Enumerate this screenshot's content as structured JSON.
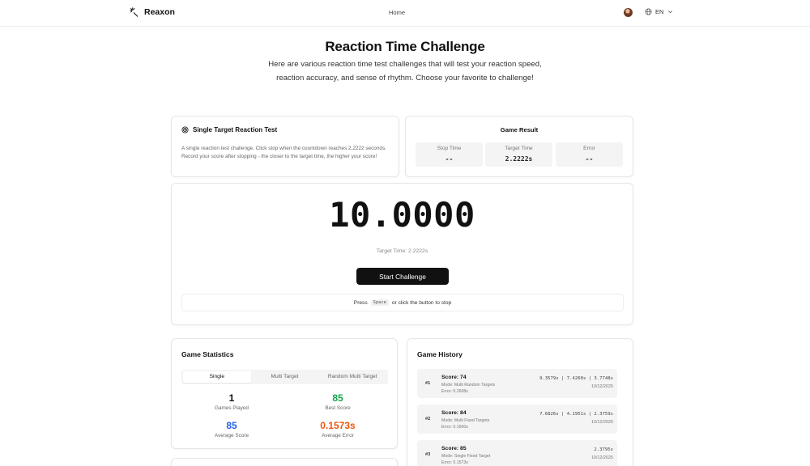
{
  "header": {
    "brand": "Reaxon",
    "nav_home": "Home",
    "lang": "EN"
  },
  "hero": {
    "title": "Reaction Time Challenge",
    "description": "Here are various reaction time test challenges that will test your reaction speed, reaction accuracy, and sense of rhythm. Choose your favorite to challenge!"
  },
  "info": {
    "title": "Single Target Reaction Test",
    "description": "A single reaction test challenge. Click stop when the countdown reaches 2.2222 seconds. Record your score after stopping - the closer to the target time, the higher your score!"
  },
  "result": {
    "title": "Game Result",
    "metrics": [
      {
        "label": "Stop Time",
        "value": "--"
      },
      {
        "label": "Target Time",
        "value": "2.2222s"
      },
      {
        "label": "Error",
        "value": "--"
      }
    ]
  },
  "timer": {
    "value": "10.0000",
    "target_label": "Target Time: 2.2222s",
    "start_label": "Start Challenge",
    "hint_pre": "Press",
    "hint_key": "Space",
    "hint_post": "or click the button to stop"
  },
  "stats": {
    "title": "Game Statistics",
    "tabs": [
      "Single",
      "Multi Target",
      "Random Multi Target"
    ],
    "items": [
      {
        "value": "1",
        "label": "Games Played",
        "color": "#111111"
      },
      {
        "value": "85",
        "label": "Best Score",
        "color": "#16a34a"
      },
      {
        "value": "85",
        "label": "Average Score",
        "color": "#2563eb"
      },
      {
        "value": "0.1573s",
        "label": "Average Error",
        "color": "#ea580c"
      }
    ]
  },
  "history": {
    "title": "Game History",
    "items": [
      {
        "rank": "#1",
        "score": "Score: 74",
        "mode": "Mode: Multi Random Targets",
        "error": "Error: 0.2608s",
        "times": "9.3579s | 7.4260s | 3.7748s",
        "date": "10/12/2025"
      },
      {
        "rank": "#2",
        "score": "Score: 84",
        "mode": "Mode: Multi Fixed Targets",
        "error": "Error: 0.1660s",
        "times": "7.6826s | 4.1951s | 2.3759s",
        "date": "10/12/2025"
      },
      {
        "rank": "#3",
        "score": "Score: 85",
        "mode": "Mode: Single Fixed Target",
        "error": "Error: 0.1573s",
        "times": "2.3795s",
        "date": "10/12/2025"
      }
    ]
  },
  "colors": {
    "accent": "#111111",
    "best": "#16a34a",
    "average": "#2563eb",
    "error": "#ea580c"
  }
}
